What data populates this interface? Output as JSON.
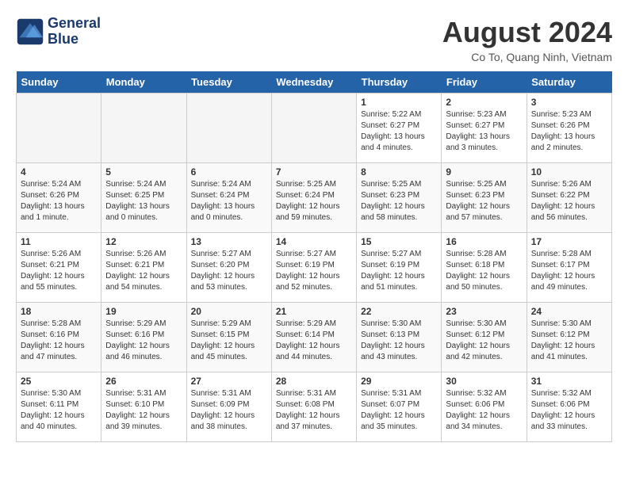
{
  "header": {
    "logo_line1": "General",
    "logo_line2": "Blue",
    "month_title": "August 2024",
    "location": "Co To, Quang Ninh, Vietnam"
  },
  "days_of_week": [
    "Sunday",
    "Monday",
    "Tuesday",
    "Wednesday",
    "Thursday",
    "Friday",
    "Saturday"
  ],
  "weeks": [
    [
      {
        "day": "",
        "info": ""
      },
      {
        "day": "",
        "info": ""
      },
      {
        "day": "",
        "info": ""
      },
      {
        "day": "",
        "info": ""
      },
      {
        "day": "1",
        "info": "Sunrise: 5:22 AM\nSunset: 6:27 PM\nDaylight: 13 hours\nand 4 minutes."
      },
      {
        "day": "2",
        "info": "Sunrise: 5:23 AM\nSunset: 6:27 PM\nDaylight: 13 hours\nand 3 minutes."
      },
      {
        "day": "3",
        "info": "Sunrise: 5:23 AM\nSunset: 6:26 PM\nDaylight: 13 hours\nand 2 minutes."
      }
    ],
    [
      {
        "day": "4",
        "info": "Sunrise: 5:24 AM\nSunset: 6:26 PM\nDaylight: 13 hours\nand 1 minute."
      },
      {
        "day": "5",
        "info": "Sunrise: 5:24 AM\nSunset: 6:25 PM\nDaylight: 13 hours\nand 0 minutes."
      },
      {
        "day": "6",
        "info": "Sunrise: 5:24 AM\nSunset: 6:24 PM\nDaylight: 13 hours\nand 0 minutes."
      },
      {
        "day": "7",
        "info": "Sunrise: 5:25 AM\nSunset: 6:24 PM\nDaylight: 12 hours\nand 59 minutes."
      },
      {
        "day": "8",
        "info": "Sunrise: 5:25 AM\nSunset: 6:23 PM\nDaylight: 12 hours\nand 58 minutes."
      },
      {
        "day": "9",
        "info": "Sunrise: 5:25 AM\nSunset: 6:23 PM\nDaylight: 12 hours\nand 57 minutes."
      },
      {
        "day": "10",
        "info": "Sunrise: 5:26 AM\nSunset: 6:22 PM\nDaylight: 12 hours\nand 56 minutes."
      }
    ],
    [
      {
        "day": "11",
        "info": "Sunrise: 5:26 AM\nSunset: 6:21 PM\nDaylight: 12 hours\nand 55 minutes."
      },
      {
        "day": "12",
        "info": "Sunrise: 5:26 AM\nSunset: 6:21 PM\nDaylight: 12 hours\nand 54 minutes."
      },
      {
        "day": "13",
        "info": "Sunrise: 5:27 AM\nSunset: 6:20 PM\nDaylight: 12 hours\nand 53 minutes."
      },
      {
        "day": "14",
        "info": "Sunrise: 5:27 AM\nSunset: 6:19 PM\nDaylight: 12 hours\nand 52 minutes."
      },
      {
        "day": "15",
        "info": "Sunrise: 5:27 AM\nSunset: 6:19 PM\nDaylight: 12 hours\nand 51 minutes."
      },
      {
        "day": "16",
        "info": "Sunrise: 5:28 AM\nSunset: 6:18 PM\nDaylight: 12 hours\nand 50 minutes."
      },
      {
        "day": "17",
        "info": "Sunrise: 5:28 AM\nSunset: 6:17 PM\nDaylight: 12 hours\nand 49 minutes."
      }
    ],
    [
      {
        "day": "18",
        "info": "Sunrise: 5:28 AM\nSunset: 6:16 PM\nDaylight: 12 hours\nand 47 minutes."
      },
      {
        "day": "19",
        "info": "Sunrise: 5:29 AM\nSunset: 6:16 PM\nDaylight: 12 hours\nand 46 minutes."
      },
      {
        "day": "20",
        "info": "Sunrise: 5:29 AM\nSunset: 6:15 PM\nDaylight: 12 hours\nand 45 minutes."
      },
      {
        "day": "21",
        "info": "Sunrise: 5:29 AM\nSunset: 6:14 PM\nDaylight: 12 hours\nand 44 minutes."
      },
      {
        "day": "22",
        "info": "Sunrise: 5:30 AM\nSunset: 6:13 PM\nDaylight: 12 hours\nand 43 minutes."
      },
      {
        "day": "23",
        "info": "Sunrise: 5:30 AM\nSunset: 6:12 PM\nDaylight: 12 hours\nand 42 minutes."
      },
      {
        "day": "24",
        "info": "Sunrise: 5:30 AM\nSunset: 6:12 PM\nDaylight: 12 hours\nand 41 minutes."
      }
    ],
    [
      {
        "day": "25",
        "info": "Sunrise: 5:30 AM\nSunset: 6:11 PM\nDaylight: 12 hours\nand 40 minutes."
      },
      {
        "day": "26",
        "info": "Sunrise: 5:31 AM\nSunset: 6:10 PM\nDaylight: 12 hours\nand 39 minutes."
      },
      {
        "day": "27",
        "info": "Sunrise: 5:31 AM\nSunset: 6:09 PM\nDaylight: 12 hours\nand 38 minutes."
      },
      {
        "day": "28",
        "info": "Sunrise: 5:31 AM\nSunset: 6:08 PM\nDaylight: 12 hours\nand 37 minutes."
      },
      {
        "day": "29",
        "info": "Sunrise: 5:31 AM\nSunset: 6:07 PM\nDaylight: 12 hours\nand 35 minutes."
      },
      {
        "day": "30",
        "info": "Sunrise: 5:32 AM\nSunset: 6:06 PM\nDaylight: 12 hours\nand 34 minutes."
      },
      {
        "day": "31",
        "info": "Sunrise: 5:32 AM\nSunset: 6:06 PM\nDaylight: 12 hours\nand 33 minutes."
      }
    ]
  ]
}
